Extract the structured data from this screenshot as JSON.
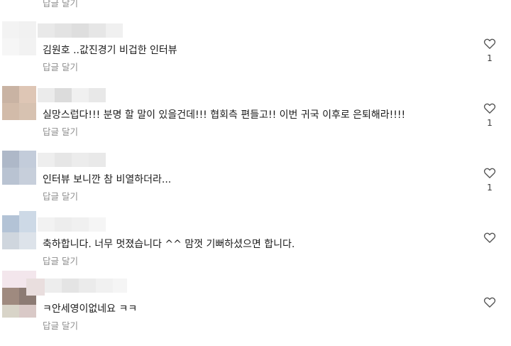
{
  "top_partial": {
    "reply_label": "답글 달기"
  },
  "icons": {
    "like": "heart-outline-icon"
  },
  "comments": [
    {
      "text": "김원호 ..값진경기 비겁한 인터뷰",
      "reply_label": "답글 달기",
      "like_count": "1"
    },
    {
      "text": "실망스럽다!!! 분명 할 말이 있을건데!!! 협회측 편들고!! 이번 귀국 이후로 은퇴해라!!!!",
      "reply_label": "답글 달기",
      "like_count": "1"
    },
    {
      "text": "인터뷰 보니깐 참 비열하더라...",
      "reply_label": "답글 달기",
      "like_count": "1"
    },
    {
      "text": "축하합니다. 너무 멋졌습니다 ^^ 맘껏 기뻐하셨으면 합니다.",
      "reply_label": "답글 달기",
      "like_count": ""
    },
    {
      "text": "ㅋ안세영이없네요 ㅋㅋ",
      "reply_label": "답글 달기",
      "like_count": ""
    }
  ]
}
